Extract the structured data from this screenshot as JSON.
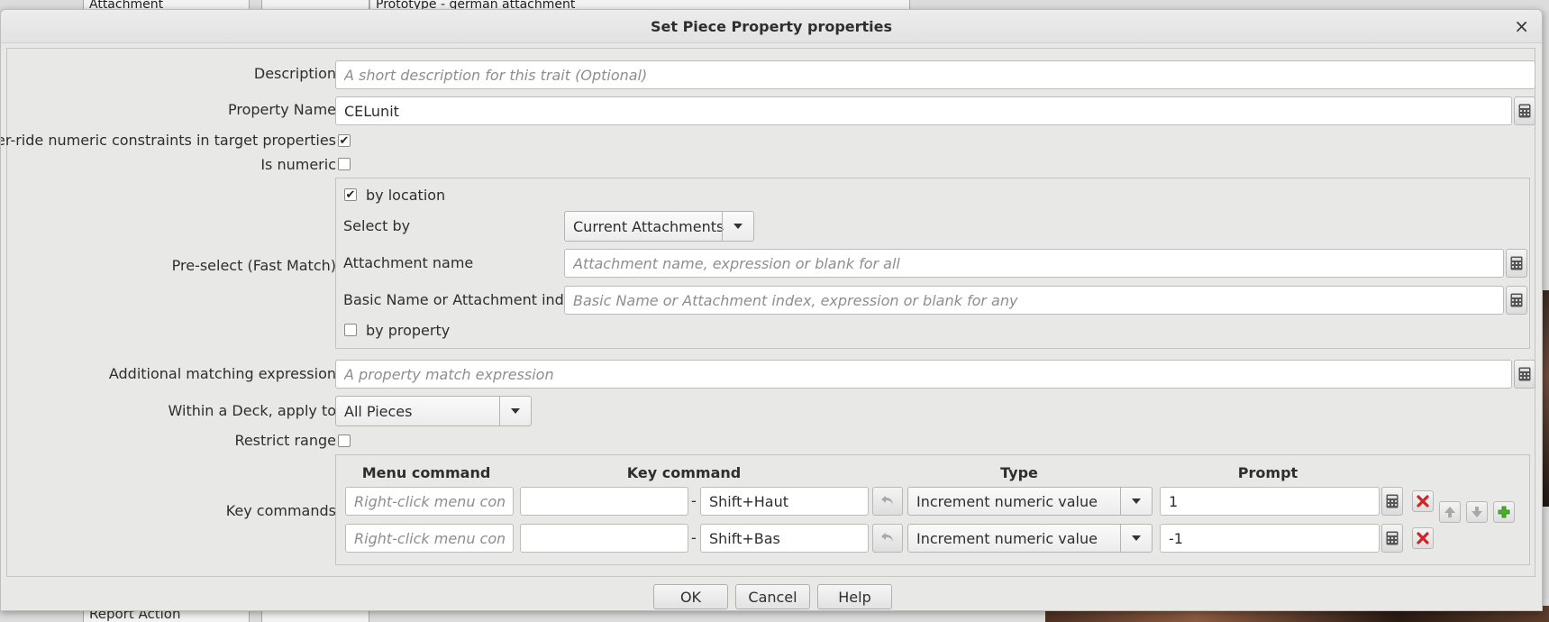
{
  "background": {
    "top_cell_1": "Attachment",
    "top_cell_2": "Prototype - german attachment",
    "bottom_cell_1": "Report Action"
  },
  "dialog": {
    "title": "Set Piece Property properties",
    "close": "×"
  },
  "form": {
    "description": {
      "label": "Description",
      "value": "",
      "placeholder": "A short description for this trait (Optional)"
    },
    "property_name": {
      "label": "Property Name",
      "value": "CELunit"
    },
    "override": {
      "label": "Over-ride numeric constraints in target properties",
      "checked": true
    },
    "is_numeric": {
      "label": "Is numeric",
      "checked": false
    },
    "preselect": {
      "label": "Pre-select (Fast Match)",
      "by_location": {
        "label": "by location",
        "checked": true
      },
      "select_by": {
        "label": "Select by",
        "value": "Current Attachments"
      },
      "attachment_name": {
        "label": "Attachment name",
        "placeholder": "Attachment name, expression or blank for all"
      },
      "basic_name": {
        "label": "Basic Name or Attachment index",
        "placeholder": "Basic Name or Attachment index, expression or blank for any"
      },
      "by_property": {
        "label": "by property",
        "checked": false
      }
    },
    "additional": {
      "label": "Additional matching expression",
      "placeholder": "A property match expression"
    },
    "within_deck": {
      "label": "Within a Deck, apply to",
      "value": "All Pieces"
    },
    "restrict_range": {
      "label": "Restrict range",
      "checked": false
    },
    "key_commands": {
      "label": "Key commands",
      "headers": {
        "menu": "Menu command",
        "key": "Key command",
        "type": "Type",
        "prompt": "Prompt"
      },
      "rows": [
        {
          "menu_placeholder": "Right-click menu command",
          "key_left": "",
          "separator": "-",
          "key_right": "Shift+Haut",
          "type": "Increment numeric value",
          "prompt": "1"
        },
        {
          "menu_placeholder": "Right-click menu command",
          "key_left": "",
          "separator": "-",
          "key_right": "Shift+Bas",
          "type": "Increment numeric value",
          "prompt": "-1"
        }
      ]
    }
  },
  "buttons": {
    "ok": "OK",
    "cancel": "Cancel",
    "help": "Help"
  },
  "colors": {
    "delete": "#d22424",
    "add": "#4caf2a",
    "dialog_bg": "#e8e8e7"
  }
}
